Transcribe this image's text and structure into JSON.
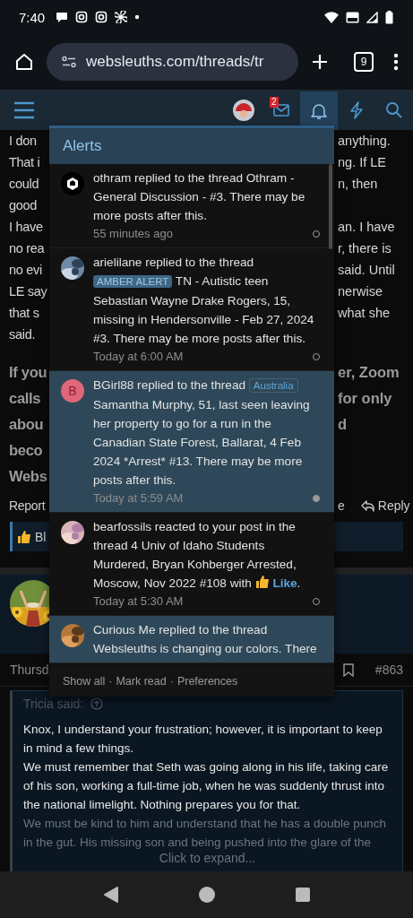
{
  "status_bar": {
    "time": "7:40"
  },
  "browser": {
    "url": "websleuths.com/threads/tr",
    "tab_count": "9"
  },
  "nav": {
    "items": [
      {
        "kind": "menu",
        "selected": false
      },
      {
        "kind": "avatar",
        "selected": false
      },
      {
        "kind": "inbox",
        "badge": "2",
        "selected": false
      },
      {
        "kind": "alerts",
        "selected": true
      },
      {
        "kind": "whats_new",
        "selected": false
      },
      {
        "kind": "search",
        "selected": false
      }
    ]
  },
  "post": {
    "lines": [
      {
        "left": "I don",
        "right": "anything."
      },
      {
        "left": "That i",
        "right": "ng. If LE"
      },
      {
        "left": "could",
        "right": "n, then"
      },
      {
        "left": "good"
      },
      {
        "left": "I have",
        "right": "an. I have"
      },
      {
        "left": "no rea",
        "right": "r, there is"
      },
      {
        "left": "no evi",
        "right": "said. Until"
      },
      {
        "left": "LE say",
        "right": "nerwise"
      },
      {
        "left": "that s",
        "right": "what she"
      },
      {
        "left": "said."
      }
    ],
    "emphasis_lines": [
      {
        "left": "If you",
        "right": "er, Zoom"
      },
      {
        "left": "calls",
        "right": "for only"
      },
      {
        "left": "abou",
        "right": "d"
      },
      {
        "left": "beco"
      },
      {
        "left": "Webs"
      }
    ],
    "actions": {
      "report": "Report",
      "fragment": "e",
      "reply": "Reply"
    },
    "reaction_bar": {
      "text": "Bl"
    }
  },
  "next_post": {
    "date": "Thursd",
    "number": "#863",
    "quote": {
      "author": "Tricia said:",
      "paragraphs": [
        "Knox, I understand your frustration; however, it is important to keep in mind a few things.",
        "We must remember that Seth was going along in his life, taking care of his son, working a full-time job, when he was suddenly thrust into the national limelight. Nothing prepares you for that."
      ],
      "faded": "We must be kind to him and understand that he has a double punch in the gut. His missing son and being pushed into the glare of the",
      "expand": "Click to expand..."
    }
  },
  "alerts": {
    "title": "Alerts",
    "items": [
      {
        "unread": false,
        "avatar": {
          "kind": "logo"
        },
        "lead": "othram replied to the thread Othram - General Discussion - #3. There may be more posts after this.",
        "time": "55 minutes ago"
      },
      {
        "unread": false,
        "lead": "arielilane replied to the thread",
        "tag": {
          "kind": "filled",
          "label": "AMBER ALERT"
        },
        "text": "TN - Autistic teen Sebastian Wayne Drake Rogers, 15, missing in Hendersonville - Feb 27, 2024 #3. There may be more posts after this.",
        "time": "Today at 6:00 AM"
      },
      {
        "unread": true,
        "avatar": {
          "kind": "letter",
          "letter": "B"
        },
        "lead": "BGirl88 replied to the thread",
        "tag": {
          "kind": "outline",
          "label": "Australia"
        },
        "text": "Samantha Murphy, 51, last seen leaving her property to go for a run in the Canadian State Forest, Ballarat, 4 Feb 2024 *Arrest* #13. There may be more posts after this.",
        "time": "Today at 5:59 AM"
      },
      {
        "unread": false,
        "lead": "bearfossils reacted to your post in the thread 4 Univ of Idaho Students Murdered, Bryan Kohberger Arrested, Moscow, Nov 2022 #108 with",
        "reaction": "Like",
        "end": ".",
        "time": "Today at 5:30 AM"
      },
      {
        "unread": true,
        "lead": "Curious Me replied to the thread Websleuths is changing our colors. There"
      }
    ],
    "footer": {
      "links": [
        "Show all",
        "Mark read",
        "Preferences"
      ],
      "separator": "·"
    }
  }
}
